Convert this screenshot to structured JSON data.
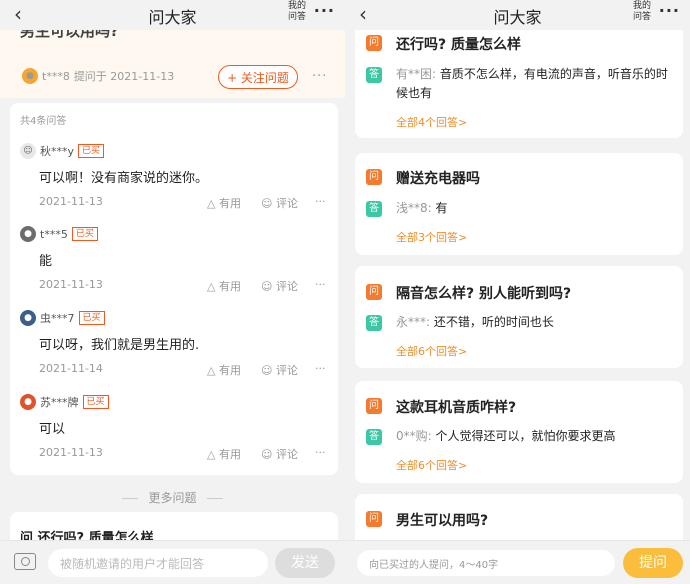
{
  "nav": {
    "back_icon": "‹",
    "title": "问大家",
    "mine": "我的问答",
    "more_icon": "···"
  },
  "left": {
    "question_cut": "男生可以用吗?",
    "asker": {
      "name": "t***8",
      "asked": "提问于 2021-11-13"
    },
    "follow_label": "+ 关注问题",
    "more_icon": "···",
    "answer_count": "共4条问答",
    "answers": [
      {
        "user": "秋***y",
        "badge": "已买",
        "text": "可以啊！没有商家说的迷你。",
        "date": "2021-11-13",
        "useful": "有用",
        "comment": "评论",
        "more": "···"
      },
      {
        "user": "t***5",
        "badge": "已买",
        "text": "能",
        "date": "2021-11-13",
        "useful": "有用",
        "comment": "评论",
        "more": "···"
      },
      {
        "user": "虫***7",
        "badge": "已买",
        "text": "可以呀，我们就是男生用的.",
        "date": "2021-11-14",
        "useful": "有用",
        "comment": "评论",
        "more": "···"
      },
      {
        "user": "苏***牌",
        "badge": "已买",
        "text": "可以",
        "date": "2021-11-13",
        "useful": "有用",
        "comment": "评论",
        "more": "···"
      }
    ],
    "more_questions": "更多问题",
    "peek_text": "问  还行吗? 质量怎么样",
    "input_placeholder": "被随机邀请的用户才能回答",
    "send_label": "发送"
  },
  "right": {
    "q_icon": "问",
    "a_icon": "答",
    "items": [
      {
        "question": "还行吗? 质量怎么样",
        "user": "有**困:",
        "answer": "音质不怎么样，有电流的声音，听音乐的时候也有",
        "all": "全部4个回答>"
      },
      {
        "question": "赠送充电器吗",
        "user": "浅**8:",
        "answer": "有",
        "all": "全部3个回答>"
      },
      {
        "question": "隔音怎么样? 别人能听到吗?",
        "user": "永***:",
        "answer": "还不错，听的时间也长",
        "all": "全部6个回答>"
      },
      {
        "question": "这款耳机音质咋样?",
        "user": "0**购:",
        "answer": "个人觉得还可以，就怕你要求更高",
        "all": "全部6个回答>"
      },
      {
        "question": "男生可以用吗?"
      }
    ],
    "input_placeholder": "向已买过的人提问，4～40字",
    "ask_label": "提问"
  }
}
